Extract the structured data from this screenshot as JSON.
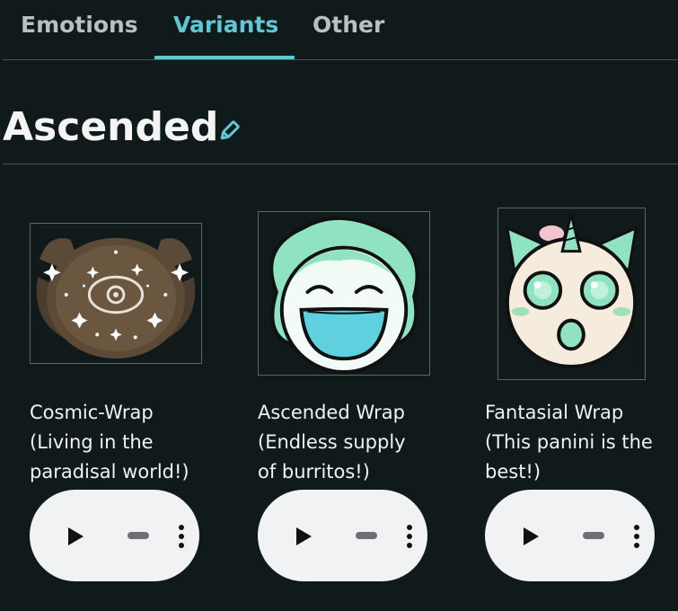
{
  "tabs": [
    {
      "label": "Emotions",
      "active": false
    },
    {
      "label": "Variants",
      "active": true
    },
    {
      "label": "Other",
      "active": false
    }
  ],
  "section": {
    "title": "Ascended",
    "edit_icon": "pencil-icon"
  },
  "cards": [
    {
      "caption_lines": [
        "Cosmic-Wrap",
        "(Living in the",
        "paradisal world!)"
      ],
      "image": "cosmic-wrap-emblem"
    },
    {
      "caption_lines": [
        "Ascended Wrap",
        "(Endless supply",
        "of burritos!)"
      ],
      "image": "ascended-wrap-laughing-face"
    },
    {
      "caption_lines": [
        "Fantasial Wrap",
        "(This panini is the",
        "best!)"
      ],
      "image": "fantasial-wrap-unicorn-face"
    }
  ],
  "player": {
    "play_icon": "play-icon",
    "more_icon": "more-vertical-icon"
  },
  "colors": {
    "background": "#101a1b",
    "accent": "#5fc6d4",
    "divider": "#4a5355",
    "player_bg": "#f1f2f3"
  }
}
